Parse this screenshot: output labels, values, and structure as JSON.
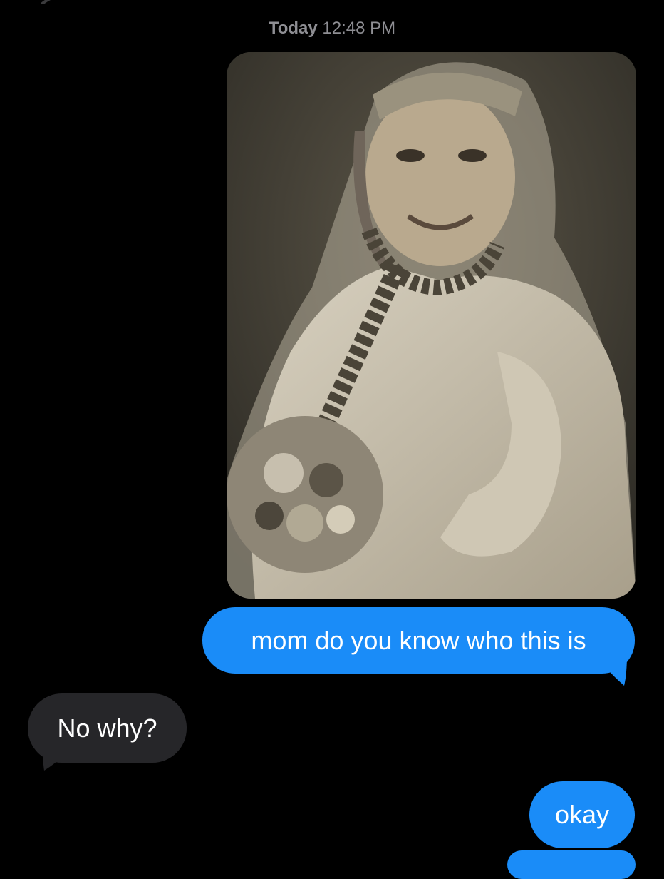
{
  "conversation": {
    "timestamp": {
      "day": "Today",
      "time": "12:48 PM"
    },
    "messages": [
      {
        "kind": "image",
        "direction": "sent",
        "description_icon": "photo-attachment"
      },
      {
        "kind": "text",
        "direction": "sent",
        "text": "mom do you know who this is"
      },
      {
        "kind": "text",
        "direction": "received",
        "text": "No why?"
      },
      {
        "kind": "text",
        "direction": "sent",
        "text": "okay"
      }
    ]
  },
  "colors": {
    "background": "#000000",
    "sent_bubble": "#1a8cf8",
    "received_bubble": "#262629",
    "timestamp_text": "#8e8e93",
    "bubble_text": "#ffffff"
  }
}
